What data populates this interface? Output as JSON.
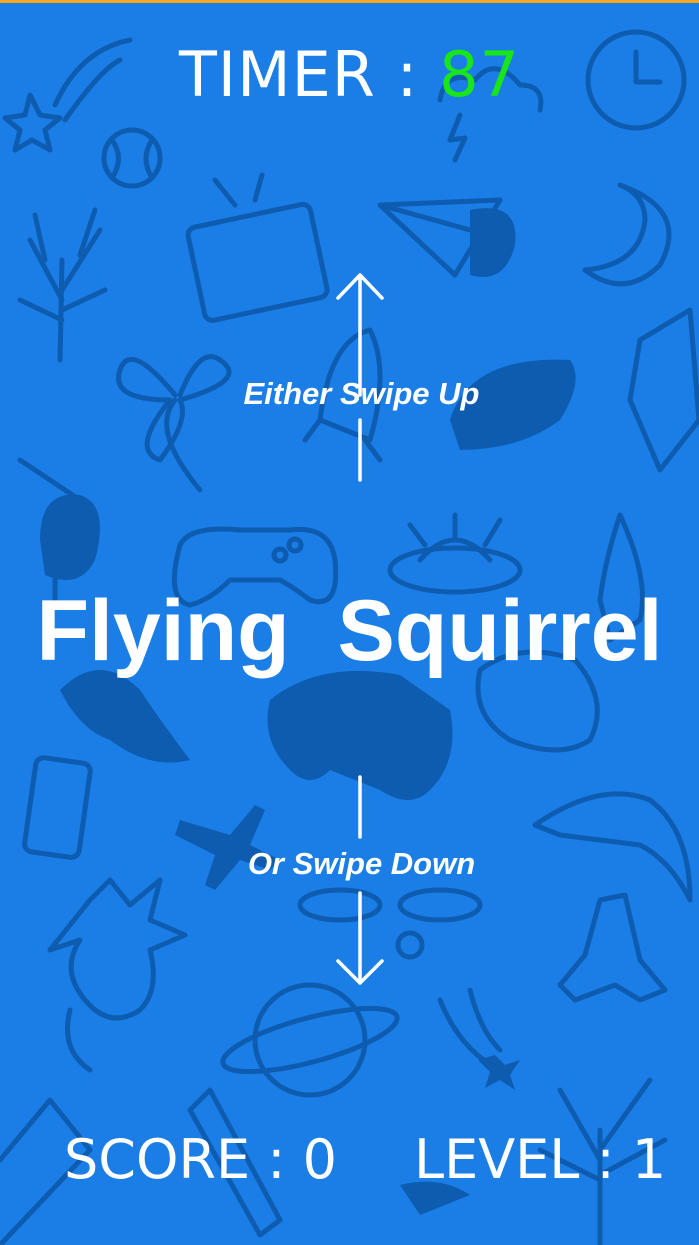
{
  "hud": {
    "timer_label": "TIMER :",
    "timer_value": "87",
    "score_label": "SCORE :",
    "score_value": "0",
    "level_label": "LEVEL :",
    "level_value": "1"
  },
  "prompt": {
    "word": "Flying  Squirrel",
    "swipe_up_text": "Either Swipe Up",
    "swipe_down_text": "Or Swipe Down"
  },
  "colors": {
    "background": "#1a7ee6",
    "doodle": "#0e5cb0",
    "timer_value": "#19e619",
    "text": "#ffffff"
  }
}
